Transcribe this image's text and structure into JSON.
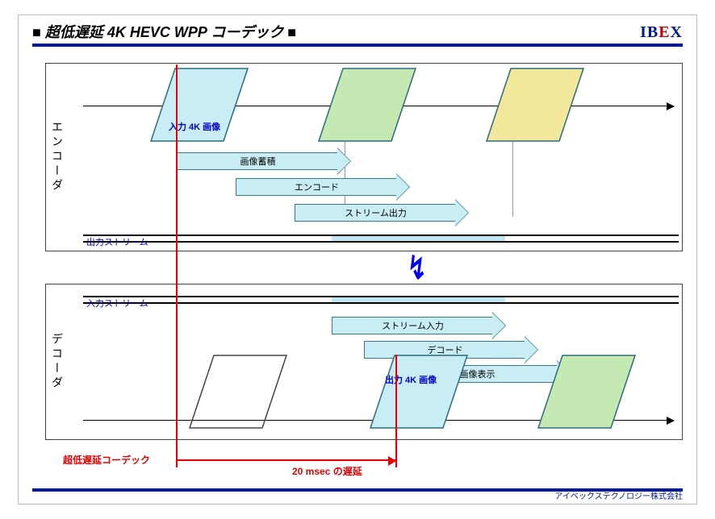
{
  "header": {
    "title": "■ 超低遅延 4K HEVC WPP コーデック ■",
    "logo_letters": {
      "i": "I",
      "b": "B",
      "e": "E",
      "x": "X"
    }
  },
  "footer": {
    "company": "アイベックステクノロジー株式会社"
  },
  "encoder": {
    "label": "エンコーダ",
    "frame_label": "入力 4K 画像",
    "proc1": "画像蓄積",
    "proc2": "エンコード",
    "proc3": "ストリーム出力",
    "stream_label": "出力ストリーム"
  },
  "decoder": {
    "label": "デコーダ",
    "stream_label": "入力ストリーム",
    "proc1": "ストリーム入力",
    "proc2": "デコード",
    "proc3": "画像表示",
    "frame_label": "出力 4K 画像"
  },
  "delay": {
    "label_left": "超低遅延コーデック",
    "label_value": "20 msec の遅延"
  },
  "colors": {
    "frame_cyan": "#c9edf4",
    "frame_green": "#c4e9b2",
    "frame_yellow": "#f2e79a",
    "frame_stroke": "#2b6d7d"
  }
}
